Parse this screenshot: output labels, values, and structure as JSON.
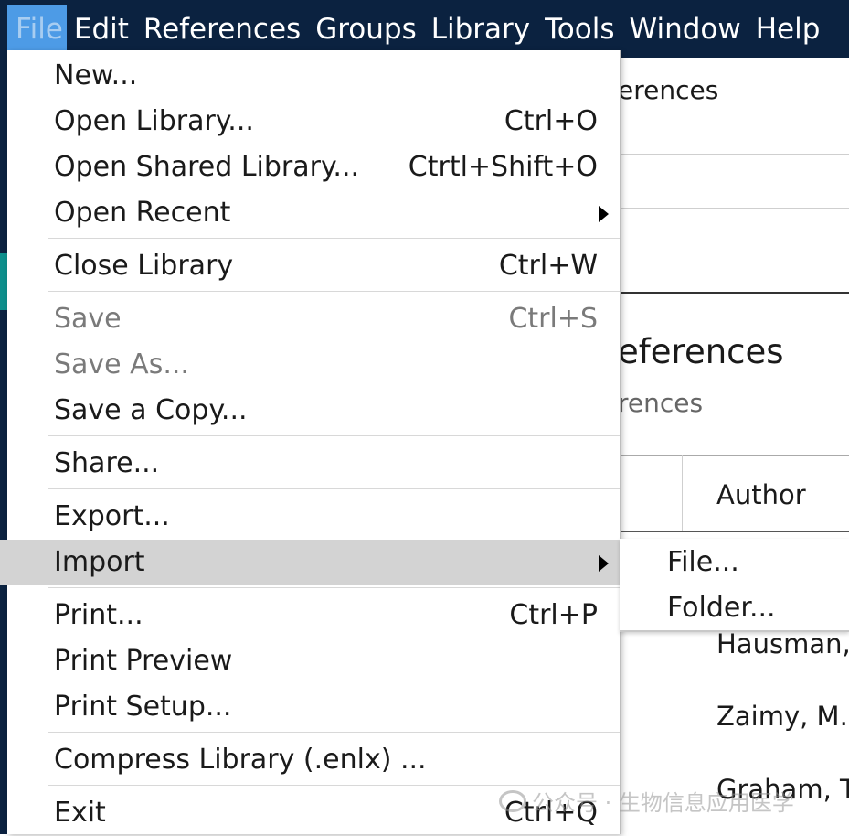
{
  "menubar": {
    "items": [
      "File",
      "Edit",
      "References",
      "Groups",
      "Library",
      "Tools",
      "Window",
      "Help"
    ],
    "active": "File"
  },
  "background": {
    "pane_header_partial": "erences",
    "section_title_partial": "eferences",
    "section_subtitle_partial": "rences",
    "column_header": "Author",
    "rows": [
      "Hausman,",
      "Zaimy, M.",
      "Graham, T"
    ]
  },
  "file_menu": {
    "items": [
      {
        "label": "New...",
        "shortcut": ""
      },
      {
        "label": "Open Library...",
        "shortcut": "Ctrl+O"
      },
      {
        "label": "Open Shared Library...",
        "shortcut": "Ctrtl+Shift+O"
      },
      {
        "label": "Open Recent",
        "shortcut": "",
        "submenu": true
      },
      {
        "label": "Close Library",
        "shortcut": "Ctrl+W"
      },
      {
        "label": "Save",
        "shortcut": "Ctrl+S",
        "disabled": true
      },
      {
        "label": "Save As...",
        "shortcut": "",
        "disabled": true
      },
      {
        "label": "Save a Copy...",
        "shortcut": ""
      },
      {
        "label": "Share...",
        "shortcut": ""
      },
      {
        "label": "Export...",
        "shortcut": ""
      },
      {
        "label": "Import",
        "shortcut": "",
        "submenu": true,
        "highlighted": true
      },
      {
        "label": "Print...",
        "shortcut": "Ctrl+P"
      },
      {
        "label": "Print Preview",
        "shortcut": ""
      },
      {
        "label": "Print Setup...",
        "shortcut": ""
      },
      {
        "label": "Compress Library (.enlx) ...",
        "shortcut": ""
      },
      {
        "label": "Exit",
        "shortcut": "Ctrl+Q"
      }
    ]
  },
  "import_submenu": {
    "items": [
      "File...",
      "Folder..."
    ]
  },
  "watermark": {
    "text": "公众号 · 生物信息应用医学"
  },
  "colors": {
    "menubar_bg": "#0b2240",
    "active_menu_bg": "#4d9be6",
    "highlight_bg": "#d3d3d3",
    "teal_accent": "#0d8f8c"
  }
}
